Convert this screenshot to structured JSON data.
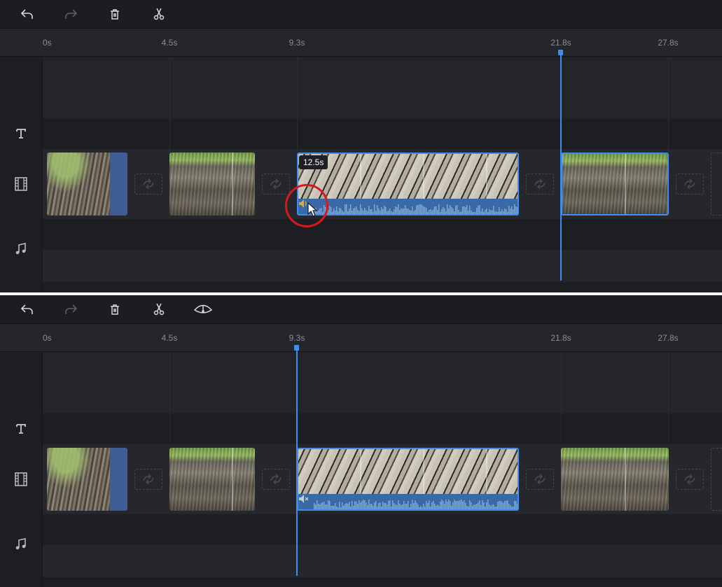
{
  "top": {
    "toolbar": {
      "buttons": [
        "undo-icon",
        "redo-icon",
        "trash-icon",
        "scissors-icon"
      ]
    },
    "ruler": {
      "ticks": [
        "0s",
        "4.5s",
        "9.3s",
        "21.8s",
        "27.8s"
      ]
    },
    "playhead_time": "21.8s",
    "selected_clip_duration": "12.5s",
    "audio_state": "unmuted"
  },
  "bottom": {
    "toolbar": {
      "buttons": [
        "undo-icon",
        "redo-icon",
        "trash-icon",
        "scissors-icon",
        "speed-icon"
      ]
    },
    "ruler": {
      "ticks": [
        "0s",
        "4.5s",
        "9.3s",
        "21.8s",
        "27.8s"
      ]
    },
    "playhead_time": "9.3s",
    "audio_state": "muted"
  },
  "tracks": [
    "text-track",
    "video-track",
    "music-track"
  ],
  "colors": {
    "accent": "#3e8ef0",
    "panel_bg": "#1d1e22",
    "waveform": "#3a6aa6",
    "highlight": "#d9181e",
    "speaker_active": "#e8a23a"
  }
}
